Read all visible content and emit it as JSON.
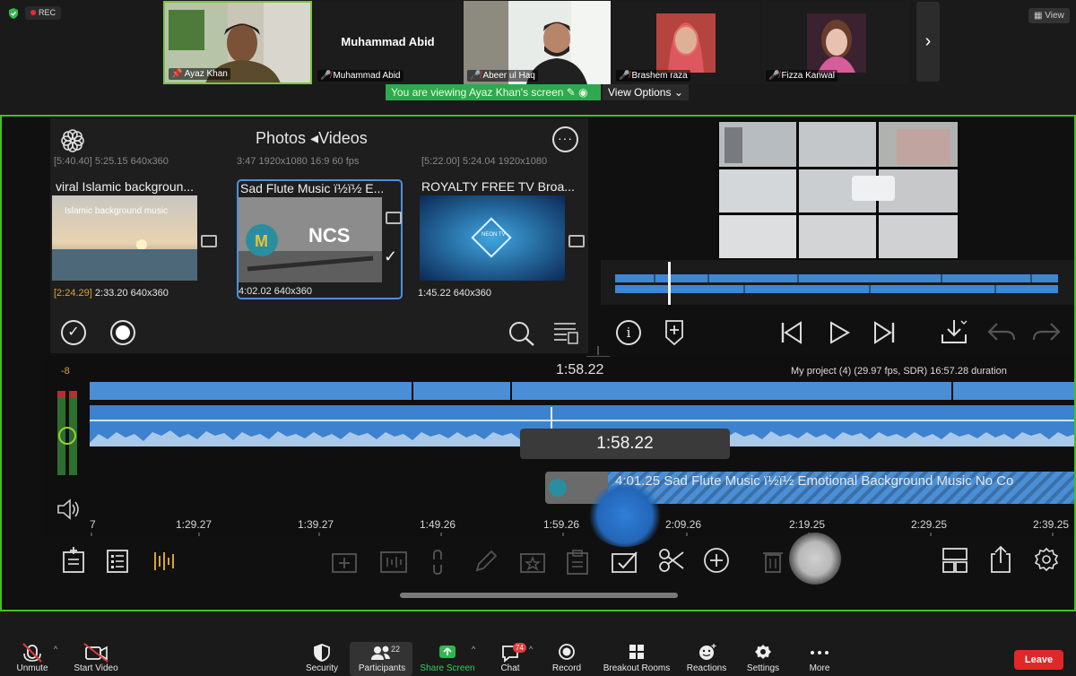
{
  "meeting": {
    "rec_label": "REC",
    "view_button": "View",
    "participants_strip": [
      {
        "name": "Ayaz Khan",
        "muted": false
      },
      {
        "name": "Muhammad Abid",
        "muted": true,
        "video_off_label": "Muhammad Abid"
      },
      {
        "name": "Abeer ul Haq",
        "muted": true
      },
      {
        "name": "Brashem raza",
        "muted": true
      },
      {
        "name": "Fizza Kanwal",
        "muted": true
      }
    ],
    "viewing_banner": "You are viewing Ayaz Khan's screen",
    "view_options": "View Options"
  },
  "editor": {
    "browser_title": "Photos ◂Videos",
    "cut_rows": [
      "[5:40.40]  5:25.15  640x360",
      "3:47  1920x1080  16:9  60 fps",
      "[5:22.00]  5:24.04  1920x1080"
    ],
    "videos": [
      {
        "title": "viral Islamic backgroun...",
        "thumb_caption": "Islamic background music",
        "duration_bracket": "[2:24.29]",
        "meta": "2:33.20  640x360",
        "selected": false
      },
      {
        "title": "Sad Flute Music ï½ï½ E...",
        "thumb_caption": "NCS",
        "duration_bracket": "",
        "meta": "4:02.02  640x360",
        "selected": true
      },
      {
        "title": "ROYALTY FREE TV Broa...",
        "thumb_caption": "NEON TV",
        "duration_bracket": "",
        "meta": "1:45.22  640x360",
        "selected": false
      }
    ],
    "timecode_top": "1:58.22",
    "project_info": "My project (4) (29.97 fps, SDR)  16:57.28 duration",
    "volume_level": "-8",
    "drag_tooltip": "1:58.22",
    "audio_clip_label": "4:01.25  Sad Flute Music ï½ï½ Emotional Background Music No Co",
    "ruler_ticks": [
      "7",
      "1:29.27",
      "1:39.27",
      "1:49.26",
      "1:59.26",
      "2:09.26",
      "2:19.25",
      "2:29.25",
      "2:39.25"
    ]
  },
  "toolbar": {
    "unmute": "Unmute",
    "start_video": "Start Video",
    "security": "Security",
    "participants": "Participants",
    "participants_count": "22",
    "share_screen": "Share Screen",
    "chat": "Chat",
    "chat_badge": "74",
    "record": "Record",
    "breakout_rooms": "Breakout Rooms",
    "reactions": "Reactions",
    "settings": "Settings",
    "more": "More",
    "leave": "Leave"
  },
  "colors": {
    "share_border": "#3fc31e",
    "banner_green": "#2fa84f",
    "clip_blue": "#4a8fd6",
    "leave_red": "#e02828"
  }
}
